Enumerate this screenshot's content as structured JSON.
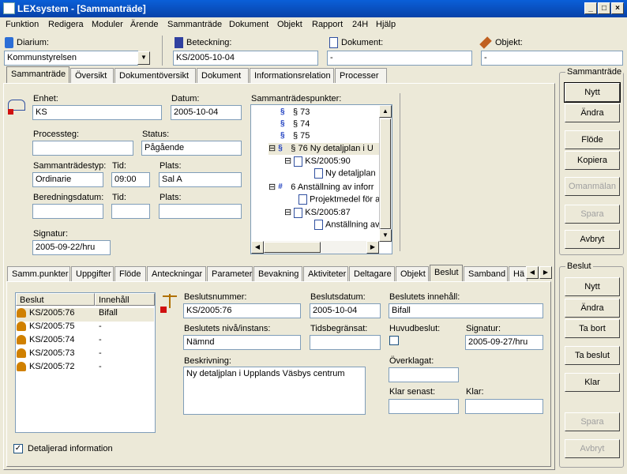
{
  "window": {
    "title": "LEXsystem - [Sammanträde]"
  },
  "menu": [
    "Funktion",
    "Redigera",
    "Moduler",
    "Ärende",
    "Sammanträde",
    "Dokument",
    "Objekt",
    "Rapport",
    "24H",
    "Hjälp"
  ],
  "top": {
    "diarium_label": "Diarium:",
    "diarium_value": "Kommunstyrelsen",
    "beteckning_label": "Beteckning:",
    "beteckning_value": "KS/2005-10-04",
    "dokument_label": "Dokument:",
    "dokument_value": "-",
    "objekt_label": "Objekt:",
    "objekt_value": "-"
  },
  "main_tabs": [
    "Sammanträde",
    "Översikt",
    "Dokumentöversikt",
    "Dokument",
    "Informationsrelation",
    "Processer"
  ],
  "form": {
    "enhet_label": "Enhet:",
    "enhet_value": "KS",
    "datum_label": "Datum:",
    "datum_value": "2005-10-04",
    "processteg_label": "Processteg:",
    "processteg_value": "",
    "status_label": "Status:",
    "status_value": "Pågående",
    "typ_label": "Sammanträdestyp:",
    "typ_value": "Ordinarie",
    "tid_label": "Tid:",
    "tid_value": "09:00",
    "plats_label": "Plats:",
    "plats_value": "Sal A",
    "berednings_label": "Beredningsdatum:",
    "berednings_value": "",
    "tid2_label": "Tid:",
    "tid2_value": "",
    "plats2_label": "Plats:",
    "plats2_value": "",
    "signatur_label": "Signatur:",
    "signatur_value": "2005-09-22/hru"
  },
  "tree": {
    "label": "Sammanträdespunkter:",
    "items": [
      "§ 73",
      "§ 74",
      "§ 75",
      "§ 76 Ny detaljplan i U",
      "KS/2005:90",
      "Ny detaljplan",
      "6 Anställning av inforr",
      "Projektmedel för a",
      "KS/2005:87",
      "Anställning av"
    ]
  },
  "right_panel": {
    "group1_title": "Sammanträde",
    "nytt": "Nytt",
    "andra": "Ändra",
    "flode": "Flöde",
    "kopiera": "Kopiera",
    "omanmalan": "Omanmälan",
    "spara": "Spara",
    "avbryt": "Avbryt",
    "group2_title": "Beslut",
    "b_nytt": "Nytt",
    "b_andra": "Ändra",
    "b_tabort": "Ta bort",
    "b_tabeslut": "Ta beslut",
    "b_klar": "Klar",
    "b_spara": "Spara",
    "b_avbryt": "Avbryt"
  },
  "sub_tabs": [
    "Samm.punkter",
    "Uppgifter",
    "Flöde",
    "Anteckningar",
    "Parameter",
    "Bevakning",
    "Aktiviteter",
    "Deltagare",
    "Objekt",
    "Beslut",
    "Samband",
    "Hä"
  ],
  "beslut_list": {
    "headers": [
      "Beslut",
      "Innehåll"
    ],
    "rows": [
      {
        "beslut": "KS/2005:76",
        "innehall": "Bifall"
      },
      {
        "beslut": "KS/2005:75",
        "innehall": "-"
      },
      {
        "beslut": "KS/2005:74",
        "innehall": "-"
      },
      {
        "beslut": "KS/2005:73",
        "innehall": "-"
      },
      {
        "beslut": "KS/2005:72",
        "innehall": "-"
      }
    ]
  },
  "beslut_form": {
    "nummer_label": "Beslutsnummer:",
    "nummer_value": "KS/2005:76",
    "datum_label": "Beslutsdatum:",
    "datum_value": "2005-10-04",
    "innehall_label": "Beslutets innehåll:",
    "innehall_value": "Bifall",
    "niva_label": "Beslutets nivå/instans:",
    "niva_value": "Nämnd",
    "tidsbegr_label": "Tidsbegränsat:",
    "tidsbegr_value": "",
    "huvud_label": "Huvudbeslut:",
    "signatur_label": "Signatur:",
    "signatur_value": "2005-09-27/hru",
    "beskrivning_label": "Beskrivning:",
    "beskrivning_value": "Ny detaljplan i Upplands Väsbys centrum",
    "overklagat_label": "Överklagat:",
    "overklagat_value": "",
    "klarsenast_label": "Klar senast:",
    "klarsenast_value": "",
    "klar_label": "Klar:",
    "klar_value": ""
  },
  "detaljerad": "Detaljerad information"
}
